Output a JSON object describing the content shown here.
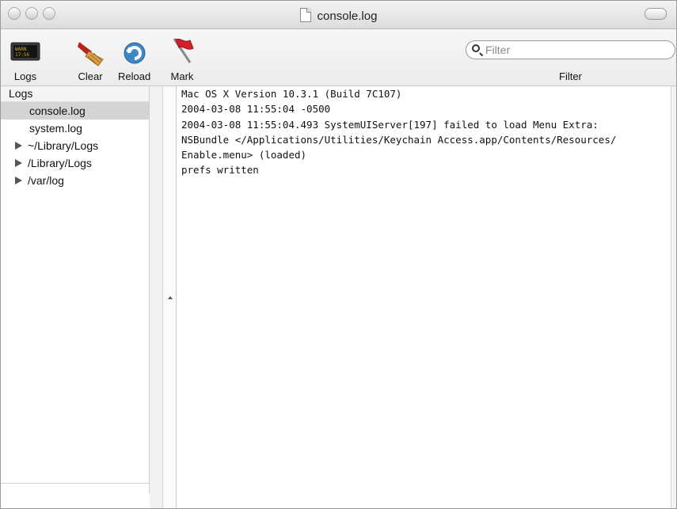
{
  "window": {
    "title": "console.log"
  },
  "toolbar": {
    "items": [
      {
        "label": "Logs",
        "icon": "logs-icon"
      },
      {
        "label": "Clear",
        "icon": "broom-icon"
      },
      {
        "label": "Reload",
        "icon": "reload-icon"
      },
      {
        "label": "Mark",
        "icon": "flag-icon"
      }
    ],
    "filter_placeholder": "Filter",
    "filter_label": "Filter"
  },
  "sidebar": {
    "header": "Logs",
    "items": [
      {
        "label": "console.log",
        "selected": true,
        "expandable": false
      },
      {
        "label": "system.log",
        "selected": false,
        "expandable": false
      },
      {
        "label": "~/Library/Logs",
        "selected": false,
        "expandable": true
      },
      {
        "label": "/Library/Logs",
        "selected": false,
        "expandable": true
      },
      {
        "label": "/var/log",
        "selected": false,
        "expandable": true
      }
    ]
  },
  "console": {
    "lines": [
      "Mac OS X Version 10.3.1 (Build 7C107)",
      "2004-03-08 11:55:04 -0500",
      "2004-03-08 11:55:04.493 SystemUIServer[197] failed to load Menu Extra:",
      "NSBundle </Applications/Utilities/Keychain Access.app/Contents/Resources/",
      "Enable.menu> (loaded)",
      "prefs written"
    ]
  },
  "colors": {
    "selection": "#d4d4d4",
    "reload_blue": "#3f86c7",
    "flag_red": "#d3202a"
  }
}
